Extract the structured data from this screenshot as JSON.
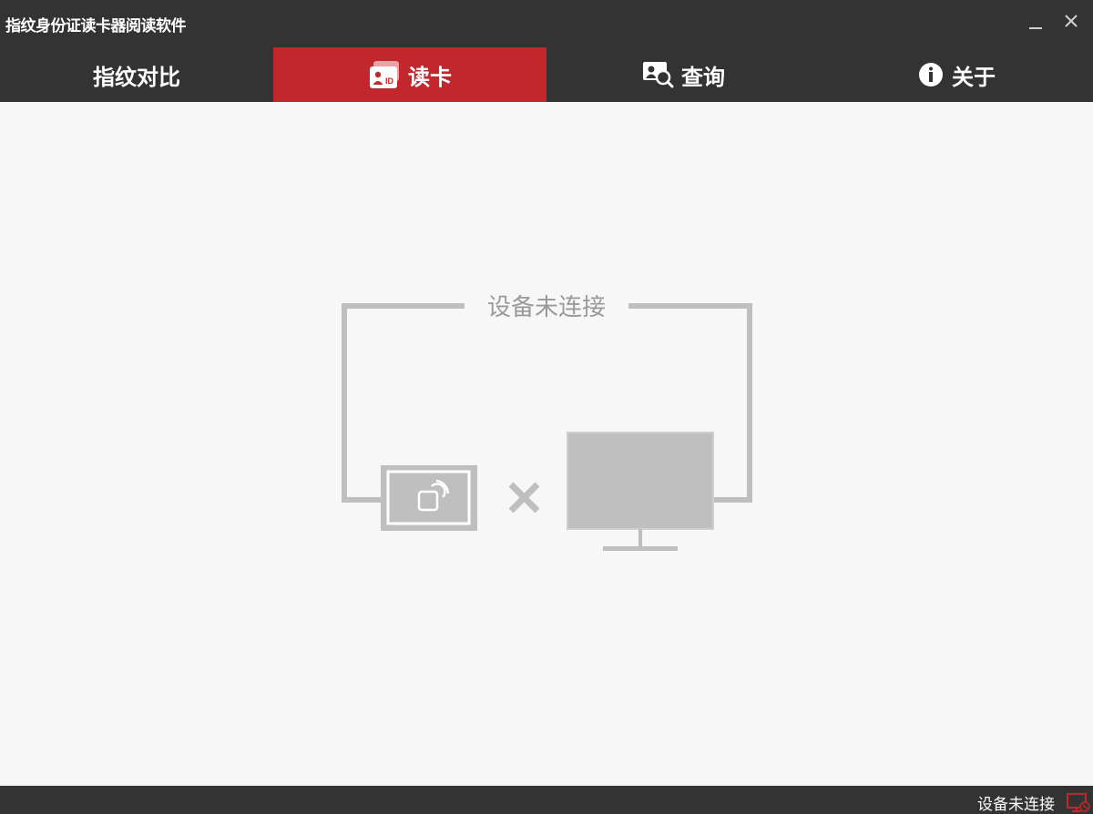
{
  "window": {
    "title": "指纹身份证读卡器阅读软件"
  },
  "tabs": [
    {
      "label": "指纹对比",
      "icon": "",
      "active": false
    },
    {
      "label": "读卡",
      "icon": "id-card-icon",
      "active": true
    },
    {
      "label": "查询",
      "icon": "person-search-icon",
      "active": false
    },
    {
      "label": "关于",
      "icon": "info-icon",
      "active": false
    }
  ],
  "main": {
    "connection_label": "设备未连接"
  },
  "status": {
    "text": "设备未连接"
  },
  "colors": {
    "titlebar": "#333333",
    "active_tab": "#c1272d",
    "diagram_gray": "#bfbfbf",
    "background": "#f7f7f7"
  }
}
